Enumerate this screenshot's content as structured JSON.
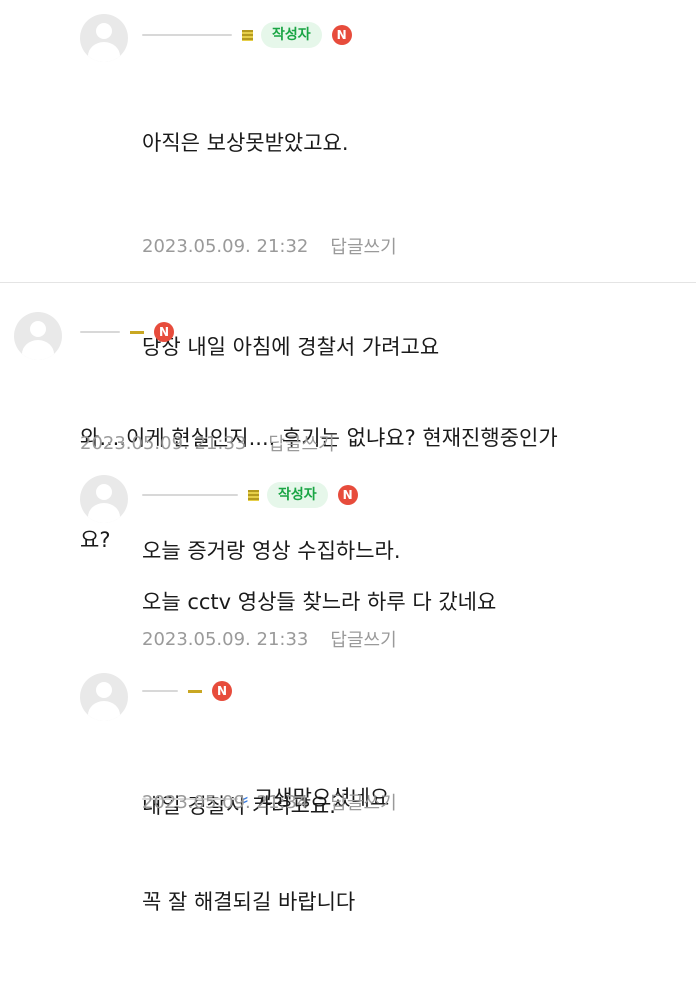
{
  "comments": [
    {
      "author_badge": "작성자",
      "new_badge": "N",
      "lines": [
        "아직은 보상못받았고요.",
        "",
        "당장 내일 아침에 경찰서 가려고요",
        "",
        "오늘 증거랑 영상 수집하느라."
      ],
      "date": "2023.05.09. 21:32",
      "reply": "답글쓰기"
    },
    {
      "new_badge": "N",
      "lines": [
        "와....이게 현실인지.... 후기는 없냐요? 현재진행중인가",
        "요?"
      ],
      "date": "2023.05.09. 21:33",
      "reply": "답글쓰기"
    },
    {
      "author_badge": "작성자",
      "new_badge": "N",
      "lines": [
        "오늘 cctv 영상들 찾느라 하루 다 갔네요",
        "",
        "내일 경찰서 가려고요."
      ],
      "date": "2023.05.09. 21:33",
      "reply": "답글쓰기"
    },
    {
      "new_badge": "N",
      "lines": [
        "고생많으셨네요",
        "꼭 잘 해결되길 바랍니다"
      ],
      "date": "2023.05.09. 21:34",
      "reply": "답글쓰기"
    }
  ]
}
